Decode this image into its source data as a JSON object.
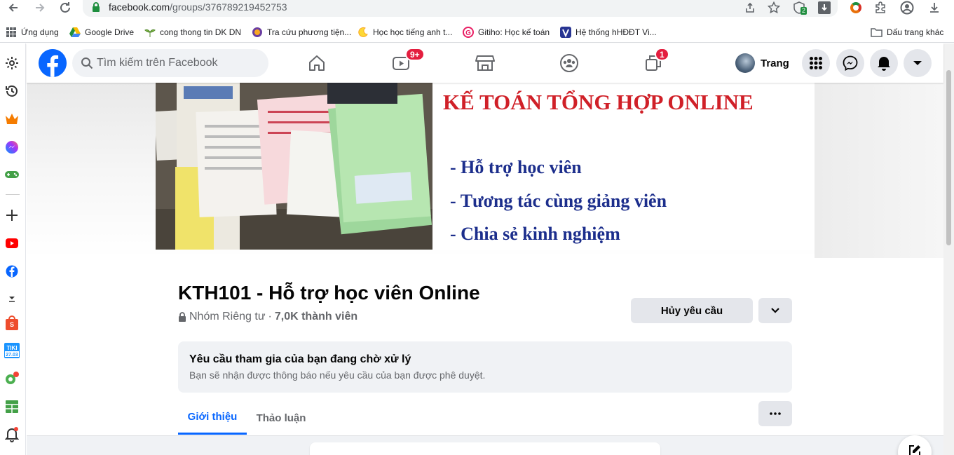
{
  "browser": {
    "url_domain": "facebook.com",
    "url_path": "/groups/376789219452753",
    "extension_badge": "2",
    "bookmarks": [
      {
        "label": "Ứng dụng",
        "icon": "apps-grid-icon"
      },
      {
        "label": "Google Drive",
        "icon": "google-drive-icon"
      },
      {
        "label": "cong thong tin DK DN",
        "icon": "plant-icon"
      },
      {
        "label": "Tra cứu phương tiện...",
        "icon": "police-badge-icon"
      },
      {
        "label": "Học học tiếng anh t...",
        "icon": "moon-icon"
      },
      {
        "label": "Gitiho: Học kế toán",
        "icon": "gitiho-icon"
      },
      {
        "label": "Hệ thống hHĐĐT Vi...",
        "icon": "v-logo-icon"
      }
    ],
    "other_bookmarks": "Dấu trang khác"
  },
  "fb": {
    "search_placeholder": "Tìm kiếm trên Facebook",
    "watch_badge": "9+",
    "gaming_badge": "1",
    "profile_name": "Trang",
    "brand_color": "#0866ff",
    "badge_color": "#e41e3f"
  },
  "cover": {
    "title": "KẾ TOÁN TỔNG HỢP ONLINE",
    "lines": [
      "- Hỗ trợ học viên",
      "- Tương tác cùng giảng viên",
      "- Chia sẻ kinh nghiệm"
    ],
    "title_color": "#d02028",
    "line_color": "#1c2e8c"
  },
  "group": {
    "name": "KTH101 - Hỗ trợ học viên Online",
    "privacy": "Nhóm Riêng tư",
    "separator": "·",
    "members": "7,0K thành viên",
    "cancel_label": "Hủy yêu cầu"
  },
  "pending": {
    "title": "Yêu cầu tham gia của bạn đang chờ xử lý",
    "subtitle": "Bạn sẽ nhận được thông báo nếu yêu cầu của bạn được phê duyệt."
  },
  "tabs": [
    {
      "label": "Giới thiệu",
      "active": true
    },
    {
      "label": "Thảo luận",
      "active": false
    }
  ]
}
